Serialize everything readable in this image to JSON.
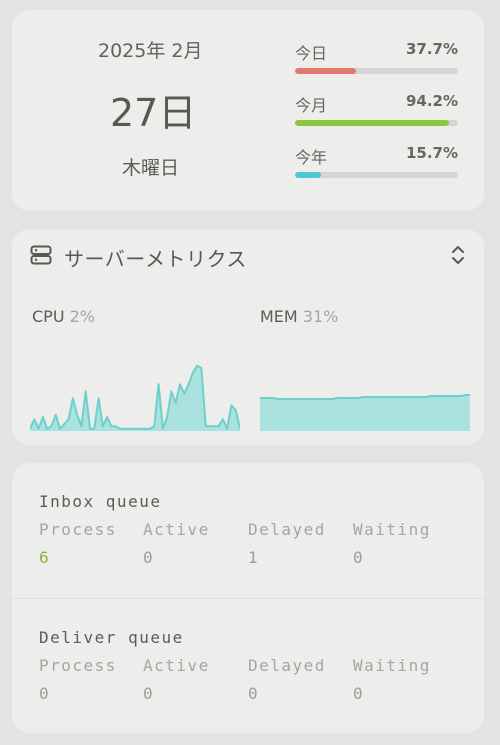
{
  "calendar": {
    "year_month": "2025年  2月",
    "day": "27日",
    "weekday": "木曜日"
  },
  "progress": [
    {
      "label": "今日",
      "value": "37.7%",
      "fraction": 0.377,
      "color": "#e2786f"
    },
    {
      "label": "今月",
      "value": "94.2%",
      "fraction": 0.942,
      "color": "#8dc53f"
    },
    {
      "label": "今年",
      "value": "15.7%",
      "fraction": 0.157,
      "color": "#4fc9cf"
    }
  ],
  "server": {
    "title": "サーバーメトリクス",
    "cpu_label": "CPU",
    "cpu_value": "2%",
    "mem_label": "MEM",
    "mem_value": "31%",
    "cpu_series": [
      1,
      5,
      1,
      6,
      1,
      2,
      7,
      1,
      3,
      5,
      14,
      7,
      2,
      17,
      1,
      1,
      14,
      2,
      6,
      2,
      2,
      1,
      1,
      1,
      1,
      1,
      1,
      1,
      1,
      2,
      20,
      1,
      6,
      17,
      12,
      20,
      16,
      20,
      25,
      28,
      27,
      2,
      2,
      2,
      2,
      5,
      1,
      11,
      9,
      1
    ],
    "mem_series": [
      33,
      33,
      33,
      33,
      32,
      32,
      32,
      32,
      32,
      32,
      32,
      32,
      32,
      32,
      32,
      32,
      32,
      32,
      33,
      33,
      33,
      33,
      33,
      33,
      34,
      34,
      34,
      34,
      34,
      34,
      34,
      34,
      34,
      34,
      34,
      34,
      34,
      34,
      34,
      34,
      35,
      35,
      35,
      35,
      35,
      35,
      35,
      35,
      36,
      36
    ],
    "colors": {
      "line": "#6fd0ca",
      "fill": "#a9e2df"
    }
  },
  "queues": [
    {
      "title": "Inbox queue",
      "headers": [
        "Process",
        "Active",
        "Delayed",
        "Waiting"
      ],
      "values": [
        "6",
        "0",
        "1",
        "0"
      ]
    },
    {
      "title": "Deliver queue",
      "headers": [
        "Process",
        "Active",
        "Delayed",
        "Waiting"
      ],
      "values": [
        "0",
        "0",
        "0",
        "0"
      ]
    }
  ]
}
